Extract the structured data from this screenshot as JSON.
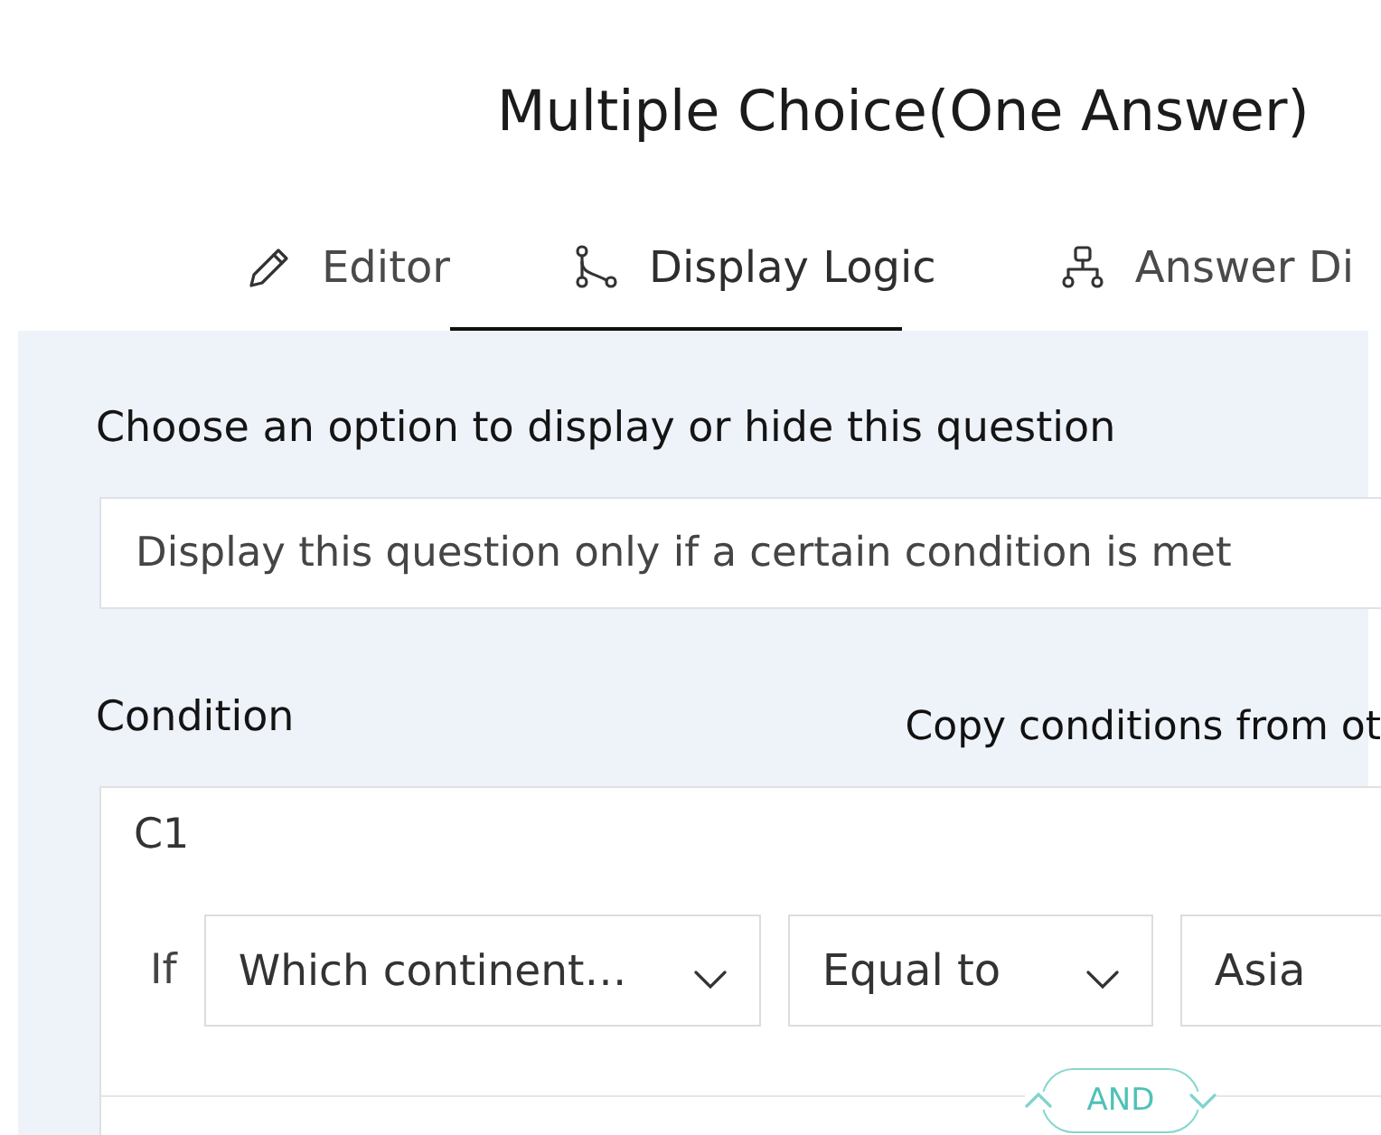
{
  "header": {
    "title": "Multiple Choice(One Answer)"
  },
  "tabs": [
    {
      "label": "Editor",
      "selected": false
    },
    {
      "label": "Display Logic",
      "selected": true
    },
    {
      "label": "Answer Di",
      "selected": false
    }
  ],
  "display_option": {
    "label": "Choose an option to display or hide this question",
    "value": "Display this question only if a certain condition is met"
  },
  "conditions_section": {
    "heading": "Condition",
    "copy_link": "Copy conditions from ot"
  },
  "conditions": [
    {
      "name": "C1",
      "prefix": "If",
      "question": "Which continent…",
      "operator": "Equal to",
      "value": "Asia"
    }
  ],
  "joiner": {
    "label": "AND"
  }
}
